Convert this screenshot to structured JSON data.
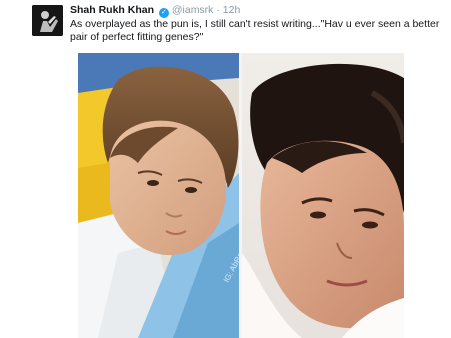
{
  "tweet": {
    "display_name": "Shah Rukh Khan",
    "handle": "@iamsrk",
    "separator": "·",
    "time": "12h",
    "text_line1": "As overplayed as the pun is, I still can't resist writing...\"Hav u ever seen a better",
    "text_line2": "pair of perfect fitting genes?\""
  },
  "media": {
    "left_watermark": "IG: AbRamKhanll"
  },
  "icons": {
    "verified": "verified-badge-icon",
    "avatar": "profile-avatar"
  },
  "colors": {
    "verified_blue": "#1da1f2",
    "handle_gray": "#8899a6",
    "text": "#14171a"
  }
}
